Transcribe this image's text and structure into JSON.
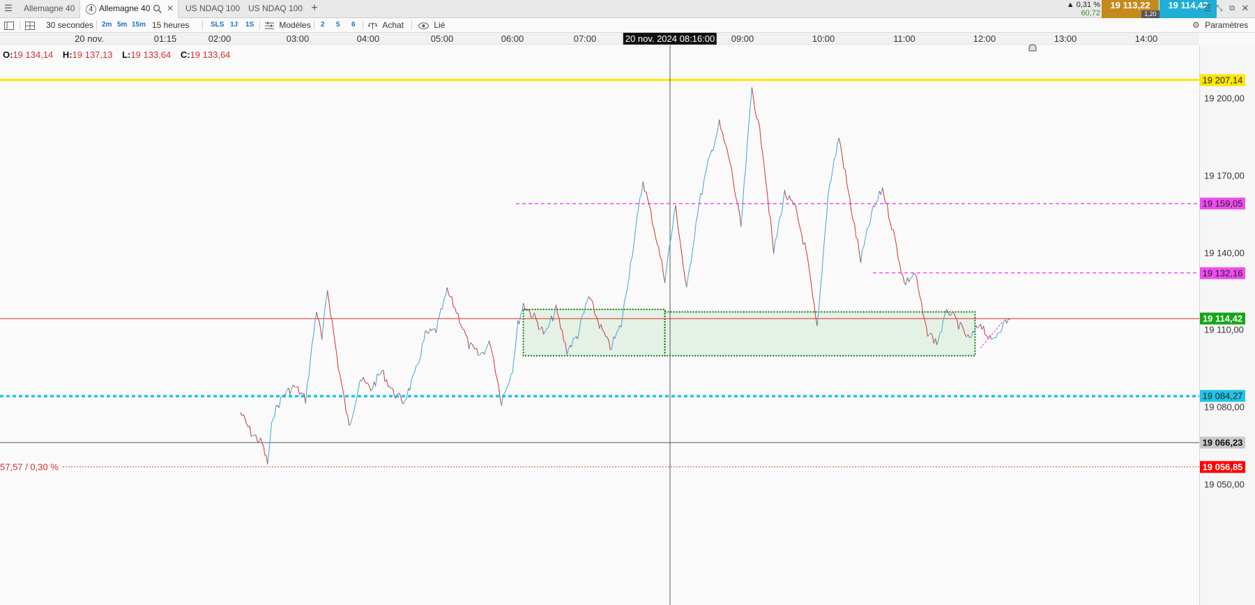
{
  "tabs": [
    {
      "label": "Allemagne 40",
      "active": false
    },
    {
      "label": "Allemagne 40",
      "active": true,
      "number": "4"
    },
    {
      "label": "US NDAQ 100",
      "active": false
    },
    {
      "label": "US NDAQ 100",
      "active": false
    }
  ],
  "quote": {
    "change_pct": "▲ 0,31 %",
    "change_abs": "60,72",
    "bid": "19 113,22",
    "ask": "19 114,42",
    "spread": "1,20",
    "bid_color": "#c58a1d",
    "ask_color": "#1eaed6"
  },
  "toolbar": {
    "interval": "30 secondes",
    "tf_2m": "2m",
    "tf_5m": "5m",
    "tf_15m": "15m",
    "period": "15 heures",
    "sls": "SLS",
    "tf_1j": "1J",
    "tf_1s": "1S",
    "models": "Modèles",
    "n2": "2",
    "n5": "5",
    "n6": "6",
    "buy": "Achat",
    "linked": "Lié",
    "settings": "Paramètres"
  },
  "time_axis": {
    "ticks": [
      "20 nov.",
      "01:15",
      "02:00",
      "03:00",
      "04:00",
      "05:00",
      "06:00",
      "07:00",
      "09:00",
      "10:00",
      "11:00",
      "12:00",
      "13:00",
      "14:00"
    ],
    "crosshair": "20 nov. 2024 08:16:00"
  },
  "ohlc": {
    "o_label": "O:",
    "o": "19 134,14",
    "h_label": "H:",
    "h": "19 137,13",
    "l_label": "L:",
    "l": "19 133,64",
    "c_label": "C:",
    "c": "19 133,64"
  },
  "price_axis": {
    "ticks": [
      "19 200,00",
      "19 170,00",
      "19 140,00",
      "19 110,00",
      "19 080,00",
      "19 050,00"
    ],
    "levels": [
      {
        "label": "19 207,14",
        "value": 19207.14,
        "bg": "#ffe600",
        "fg": "#222"
      },
      {
        "label": "19 159,05",
        "value": 19159.05,
        "bg": "#f04bf0",
        "fg": "#222"
      },
      {
        "label": "19 132,16",
        "value": 19132.16,
        "bg": "#f04bf0",
        "fg": "#222"
      },
      {
        "label": "19 114,42",
        "value": 19114.42,
        "bg": "#14a514",
        "fg": "#fff"
      },
      {
        "label": "19 084,27",
        "value": 19084.27,
        "bg": "#20c4e8",
        "fg": "#222"
      },
      {
        "label": "19 066,23",
        "value": 19066.23,
        "bg": "#c8c8c8",
        "fg": "#111"
      },
      {
        "label": "19 056,85",
        "value": 19056.85,
        "bg": "#ff0000",
        "fg": "#fff"
      }
    ]
  },
  "change_label": "57,57 / 0,30 %",
  "chart_data": {
    "type": "line",
    "title": "",
    "xlabel": "",
    "ylabel": "",
    "ylim": [
      19040,
      19215
    ],
    "x_range": [
      "00:50",
      "14:20"
    ],
    "series": [
      {
        "x": [
          "00:50",
          "01:00",
          "01:10",
          "01:15",
          "01:20",
          "01:30",
          "01:40",
          "01:50",
          "02:00",
          "02:05",
          "02:10",
          "02:20",
          "02:30",
          "02:40",
          "02:50",
          "03:00",
          "03:10",
          "03:20",
          "03:30",
          "03:40",
          "03:50",
          "04:00",
          "04:10",
          "04:20",
          "04:30",
          "04:40",
          "04:50",
          "05:00",
          "05:05",
          "05:10",
          "05:20",
          "05:30",
          "05:40",
          "05:50",
          "06:00",
          "06:10",
          "06:20",
          "06:30",
          "06:40",
          "06:50",
          "07:00",
          "07:10",
          "07:20",
          "07:30",
          "07:40",
          "07:50",
          "08:00",
          "08:10",
          "08:20",
          "08:30",
          "08:40",
          "08:50",
          "09:00",
          "09:10",
          "09:20",
          "09:30",
          "09:40",
          "09:50",
          "10:00",
          "10:10",
          "10:20",
          "10:30",
          "10:40",
          "10:50",
          "11:00",
          "11:10",
          "11:20",
          "11:30",
          "11:40",
          "11:50",
          "12:00",
          "12:10",
          "12:20",
          "12:30",
          "12:37"
        ],
        "values": [
          19078,
          19070,
          19066,
          19058,
          19077,
          19085,
          19088,
          19083,
          19118,
          19106,
          19126,
          19096,
          19072,
          19091,
          19087,
          19094,
          19086,
          19082,
          19092,
          19108,
          19110,
          19125,
          19116,
          19104,
          19100,
          19105,
          19082,
          19095,
          19112,
          19120,
          19115,
          19108,
          19118,
          19102,
          19108,
          19123,
          19112,
          19103,
          19112,
          19140,
          19168,
          19150,
          19130,
          19158,
          19125,
          19156,
          19175,
          19190,
          19175,
          19150,
          19204,
          19180,
          19140,
          19163,
          19157,
          19140,
          19110,
          19163,
          19185,
          19160,
          19137,
          19155,
          19165,
          19148,
          19128,
          19132,
          19110,
          19105,
          19118,
          19112,
          19106,
          19113,
          19105,
          19112,
          19114
        ]
      }
    ],
    "zones": [
      {
        "x_start": "05:10",
        "x_end": "07:20",
        "y_low": 19100,
        "y_high": 19118
      },
      {
        "x_start": "07:20",
        "x_end": "12:05",
        "y_low": 19100,
        "y_high": 19117
      }
    ],
    "crosshair_time": "08:16"
  }
}
